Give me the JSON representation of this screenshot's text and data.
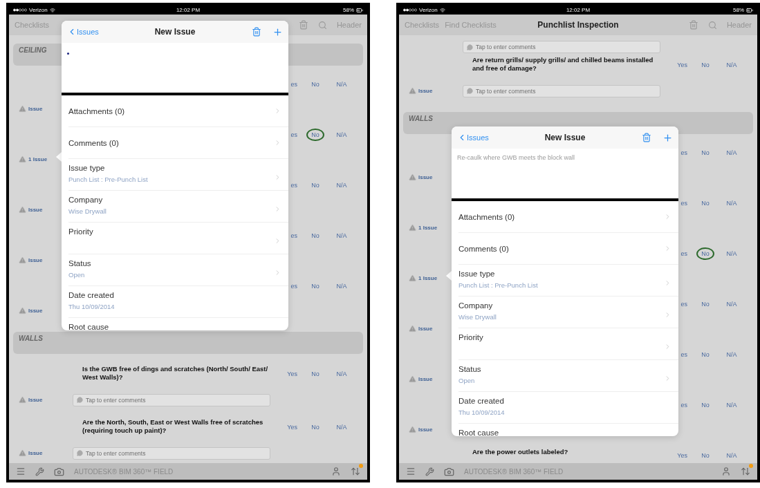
{
  "screens": [
    {
      "status_bar": {
        "carrier": "Verizon",
        "time": "12:02 PM",
        "battery": "58%"
      },
      "nav": {
        "links": [
          "Checklists"
        ],
        "action": "Header"
      },
      "rows": [
        {
          "kind": "section",
          "title": "CEILING"
        },
        {
          "kind": "answers",
          "issue": "Issue",
          "popover_anchor": false,
          "answers": [
            {
              "label": "es",
              "selected": false
            },
            {
              "label": "No",
              "selected": false
            },
            {
              "label": "N/A",
              "selected": false
            }
          ]
        },
        {
          "kind": "answers",
          "issue": "1 Issue",
          "popover_anchor": true,
          "answers": [
            {
              "label": "es",
              "selected": false
            },
            {
              "label": "No",
              "selected": true
            },
            {
              "label": "N/A",
              "selected": false
            }
          ]
        },
        {
          "kind": "answers",
          "issue": "Issue",
          "popover_anchor": false,
          "answers": [
            {
              "label": "es",
              "selected": false
            },
            {
              "label": "No",
              "selected": false
            },
            {
              "label": "N/A",
              "selected": false
            }
          ]
        },
        {
          "kind": "answers",
          "issue": "Issue",
          "popover_anchor": false,
          "answers": [
            {
              "label": "es",
              "selected": false
            },
            {
              "label": "No",
              "selected": false
            },
            {
              "label": "N/A",
              "selected": false
            }
          ]
        },
        {
          "kind": "answers",
          "issue": "Issue",
          "popover_anchor": false,
          "answers": [
            {
              "label": "es",
              "selected": false
            },
            {
              "label": "No",
              "selected": false
            },
            {
              "label": "N/A",
              "selected": false
            }
          ]
        },
        {
          "kind": "section",
          "title": "WALLS"
        },
        {
          "kind": "question",
          "text": "Is the GWB free of dings and scratches (North/ South/ East/ West Walls)?",
          "issue": "Issue",
          "comment_placeholder": "Tap to enter comments",
          "answers": [
            {
              "label": "Yes",
              "selected": false
            },
            {
              "label": "No",
              "selected": false
            },
            {
              "label": "N/A",
              "selected": false
            }
          ]
        },
        {
          "kind": "question",
          "text": "Are the North, South, East or West Walls free of scratches (requiring touch up paint)?",
          "issue": "Issue",
          "comment_placeholder": "Tap to enter comments",
          "answers": [
            {
              "label": "Yes",
              "selected": false
            },
            {
              "label": "No",
              "selected": false
            },
            {
              "label": "N/A",
              "selected": false
            }
          ]
        }
      ],
      "popover": {
        "back": "Issues",
        "title": "New Issue",
        "items": [
          {
            "label": "Attachments (0)",
            "chevron": true
          },
          {
            "label": "Comments (0)",
            "chevron": true
          },
          {
            "label": "Issue type",
            "value": "Punch List : Pre-Punch List",
            "chevron": true
          },
          {
            "label": "Company",
            "value": "Wise Drywall",
            "chevron": true
          },
          {
            "label": "Priority",
            "chevron": true
          },
          {
            "label": "Status",
            "value": "Open",
            "chevron": true
          },
          {
            "label": "Date created",
            "value": "Thu 10/09/2014",
            "chevron": false
          },
          {
            "label": "Root cause"
          }
        ]
      },
      "toolbar": {
        "brand": "AUTODESK® BIM 360™ FIELD",
        "sync_badge": true
      }
    },
    {
      "status_bar": {
        "carrier": "Verizon",
        "time": "12:02 PM",
        "battery": "58%"
      },
      "nav": {
        "links": [
          "Checklists",
          "Find Checklists"
        ],
        "title": "Punchlist Inspection",
        "action": "Header"
      },
      "rows": [
        {
          "kind": "comment",
          "comment_placeholder": "Tap to enter comments"
        },
        {
          "kind": "question",
          "text": "Are return grills/ supply grills/ and chilled beams installed and free of damage?",
          "issue": "Issue",
          "comment_placeholder": "Tap to enter comments",
          "answers": [
            {
              "label": "Yes",
              "selected": false
            },
            {
              "label": "No",
              "selected": false
            },
            {
              "label": "N/A",
              "selected": false
            }
          ]
        },
        {
          "kind": "section",
          "title": "WALLS"
        },
        {
          "kind": "answers",
          "issue": "Issue",
          "popover_anchor": false,
          "answers": [
            {
              "label": "es",
              "selected": false
            },
            {
              "label": "No",
              "selected": false
            },
            {
              "label": "N/A",
              "selected": false
            }
          ]
        },
        {
          "kind": "answers",
          "issue": "1 Issue",
          "popover_anchor": false,
          "answers": [
            {
              "label": "es",
              "selected": false
            },
            {
              "label": "No",
              "selected": false
            },
            {
              "label": "N/A",
              "selected": false
            }
          ]
        },
        {
          "kind": "answers",
          "issue": "1 Issue",
          "popover_anchor": true,
          "answers": [
            {
              "label": "es",
              "selected": false
            },
            {
              "label": "No",
              "selected": true
            },
            {
              "label": "N/A",
              "selected": false
            }
          ]
        },
        {
          "kind": "answers",
          "issue": "Issue",
          "popover_anchor": false,
          "answers": [
            {
              "label": "es",
              "selected": false
            },
            {
              "label": "No",
              "selected": false
            },
            {
              "label": "N/A",
              "selected": false
            }
          ]
        },
        {
          "kind": "answers",
          "issue": "Issue",
          "popover_anchor": false,
          "answers": [
            {
              "label": "es",
              "selected": false
            },
            {
              "label": "No",
              "selected": false
            },
            {
              "label": "N/A",
              "selected": false
            }
          ]
        },
        {
          "kind": "answers",
          "issue": "Issue",
          "popover_anchor": false,
          "answers": [
            {
              "label": "es",
              "selected": false
            },
            {
              "label": "No",
              "selected": false
            },
            {
              "label": "N/A",
              "selected": false
            }
          ]
        },
        {
          "kind": "question",
          "text": "Are the power outlets labeled?",
          "answers": [
            {
              "label": "Yes",
              "selected": false
            },
            {
              "label": "No",
              "selected": false
            },
            {
              "label": "N/A",
              "selected": false
            }
          ]
        }
      ],
      "popover": {
        "back": "Issues",
        "title": "New Issue",
        "description": "Re-caulk where GWB meets the block wall",
        "items": [
          {
            "label": "Attachments (0)",
            "chevron": true
          },
          {
            "label": "Comments (0)",
            "chevron": true
          },
          {
            "label": "Issue type",
            "value": "Punch List : Pre-Punch List",
            "chevron": true
          },
          {
            "label": "Company",
            "value": "Wise Drywall",
            "chevron": true
          },
          {
            "label": "Priority",
            "chevron": true
          },
          {
            "label": "Status",
            "value": "Open",
            "chevron": true
          },
          {
            "label": "Date created",
            "value": "Thu 10/09/2014",
            "chevron": false
          },
          {
            "label": "Root cause"
          }
        ]
      },
      "toolbar": {
        "brand": "AUTODESK® BIM 360™ FIELD",
        "sync_badge": true
      }
    }
  ]
}
